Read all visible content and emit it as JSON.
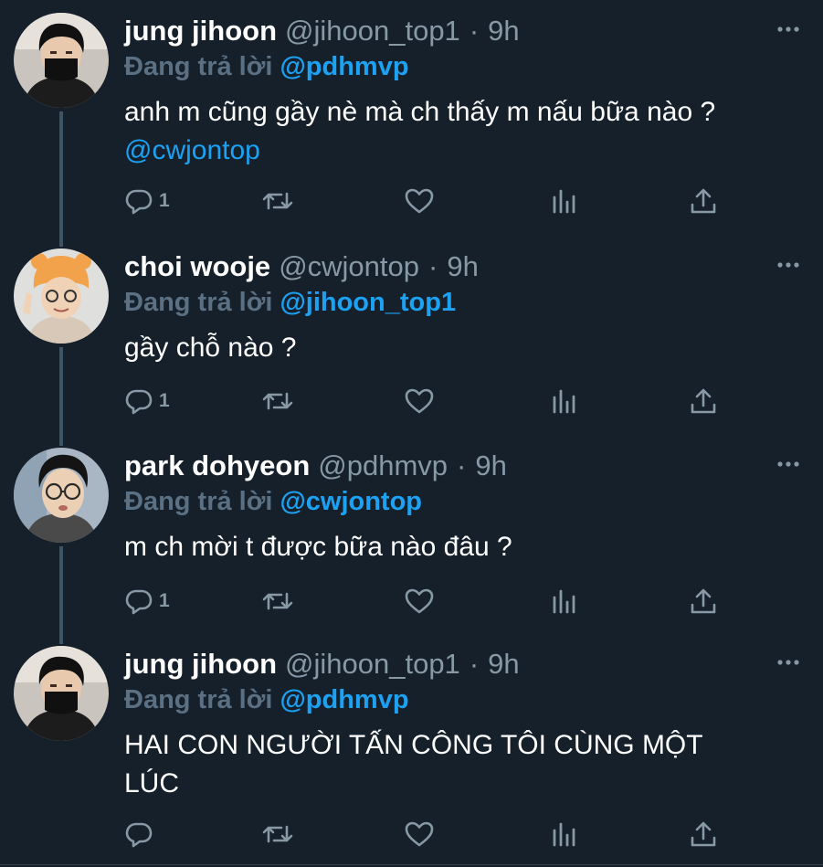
{
  "tweets": [
    {
      "name": "jung jihoon",
      "handle": "@jihoon_top1",
      "separator": "·",
      "time": "9h",
      "replying_label": "Đang trả lời",
      "replying_to": "@pdhmvp",
      "text": "anh m cũng gầy nè mà ch thấy m nấu bữa nào ?",
      "text_mention": "@cwjontop",
      "reply_count": "1",
      "avatar": "avatar-jihoon-icon"
    },
    {
      "name": "choi wooje",
      "handle": "@cwjontop",
      "separator": "·",
      "time": "9h",
      "replying_label": "Đang trả lời",
      "replying_to": "@jihoon_top1",
      "text": "gầy chỗ nào ?",
      "reply_count": "1",
      "avatar": "avatar-wooje-icon"
    },
    {
      "name": "park dohyeon",
      "handle": "@pdhmvp",
      "separator": "·",
      "time": "9h",
      "replying_label": "Đang trả lời",
      "replying_to": "@cwjontop",
      "text": "m ch mời t được bữa nào đâu ?",
      "reply_count": "1",
      "avatar": "avatar-dohyeon-icon"
    },
    {
      "name": "jung jihoon",
      "handle": "@jihoon_top1",
      "separator": "·",
      "time": "9h",
      "replying_label": "Đang trả lời",
      "replying_to": "@pdhmvp",
      "text": "HAI CON NGƯỜI TẤN CÔNG TÔI CÙNG MỘT LÚC",
      "reply_count": "",
      "avatar": "avatar-jihoon-icon"
    }
  ],
  "colors": {
    "background": "#15202b",
    "accent": "#1da1f2",
    "muted": "#8899a6",
    "thread_line": "#3d5466"
  },
  "icons": {
    "reply": "reply-icon",
    "retweet": "retweet-icon",
    "like": "heart-icon",
    "stats": "analytics-icon",
    "share": "share-icon",
    "more": "more-options-icon"
  }
}
